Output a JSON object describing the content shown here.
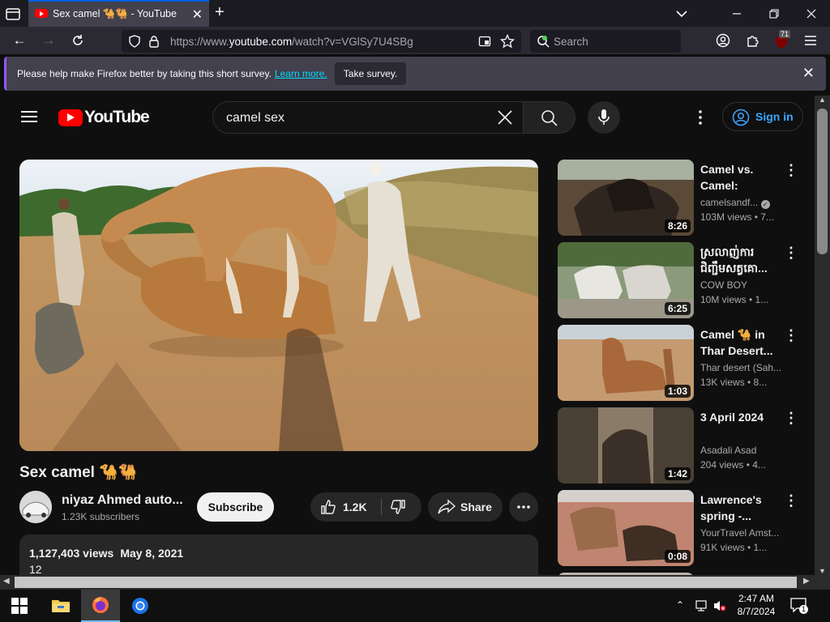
{
  "browser": {
    "tab_title": "Sex camel 🐪🐫 - YouTube",
    "url_prefix": "https://www.",
    "url_domain": "youtube.com",
    "url_suffix": "/watch?v=VGlSy7U4SBg",
    "search_placeholder": "Search",
    "extension_badge": "71"
  },
  "survey_bar": {
    "message": "Please help make Firefox better by taking this short survey.",
    "learn_more": "Learn more.",
    "take_survey": "Take survey."
  },
  "youtube": {
    "logo_text": "YouTube",
    "search_query": "camel sex",
    "sign_in": "Sign in",
    "video": {
      "title": "Sex camel 🐪🐫",
      "channel": "niyaz Ahmed auto...",
      "subscribers": "1.23K subscribers",
      "subscribe_label": "Subscribe",
      "likes": "1.2K",
      "share_label": "Share",
      "views": "1,127,403 views",
      "date": "May 8, 2021",
      "description_line": "12"
    },
    "related": [
      {
        "title": "Camel vs. Camel: Anima...",
        "channel": "camelsandf...",
        "verified": true,
        "views": "103M views • 7...",
        "duration": "8:26"
      },
      {
        "title": "ស្រលាញ់ការ ជិញ្ជឹមសត្វគោ...",
        "channel": "COW BOY",
        "verified": false,
        "views": "10M views • 1...",
        "duration": "6:25"
      },
      {
        "title": "Camel 🐪 in Thar Desert...",
        "channel": "Thar desert (Sah...",
        "verified": false,
        "views": "13K views • 8...",
        "duration": "1:03"
      },
      {
        "title": "3 April 2024",
        "channel": "Asadali Asad",
        "verified": false,
        "views": "204 views • 4...",
        "duration": "1:42"
      },
      {
        "title": "Lawrence's spring -...",
        "channel": "YourTravel Amst...",
        "verified": false,
        "views": "91K views • 1...",
        "duration": "0:08"
      }
    ]
  },
  "taskbar": {
    "time": "2:47 AM",
    "date": "8/7/2024",
    "notification_count": "1"
  }
}
